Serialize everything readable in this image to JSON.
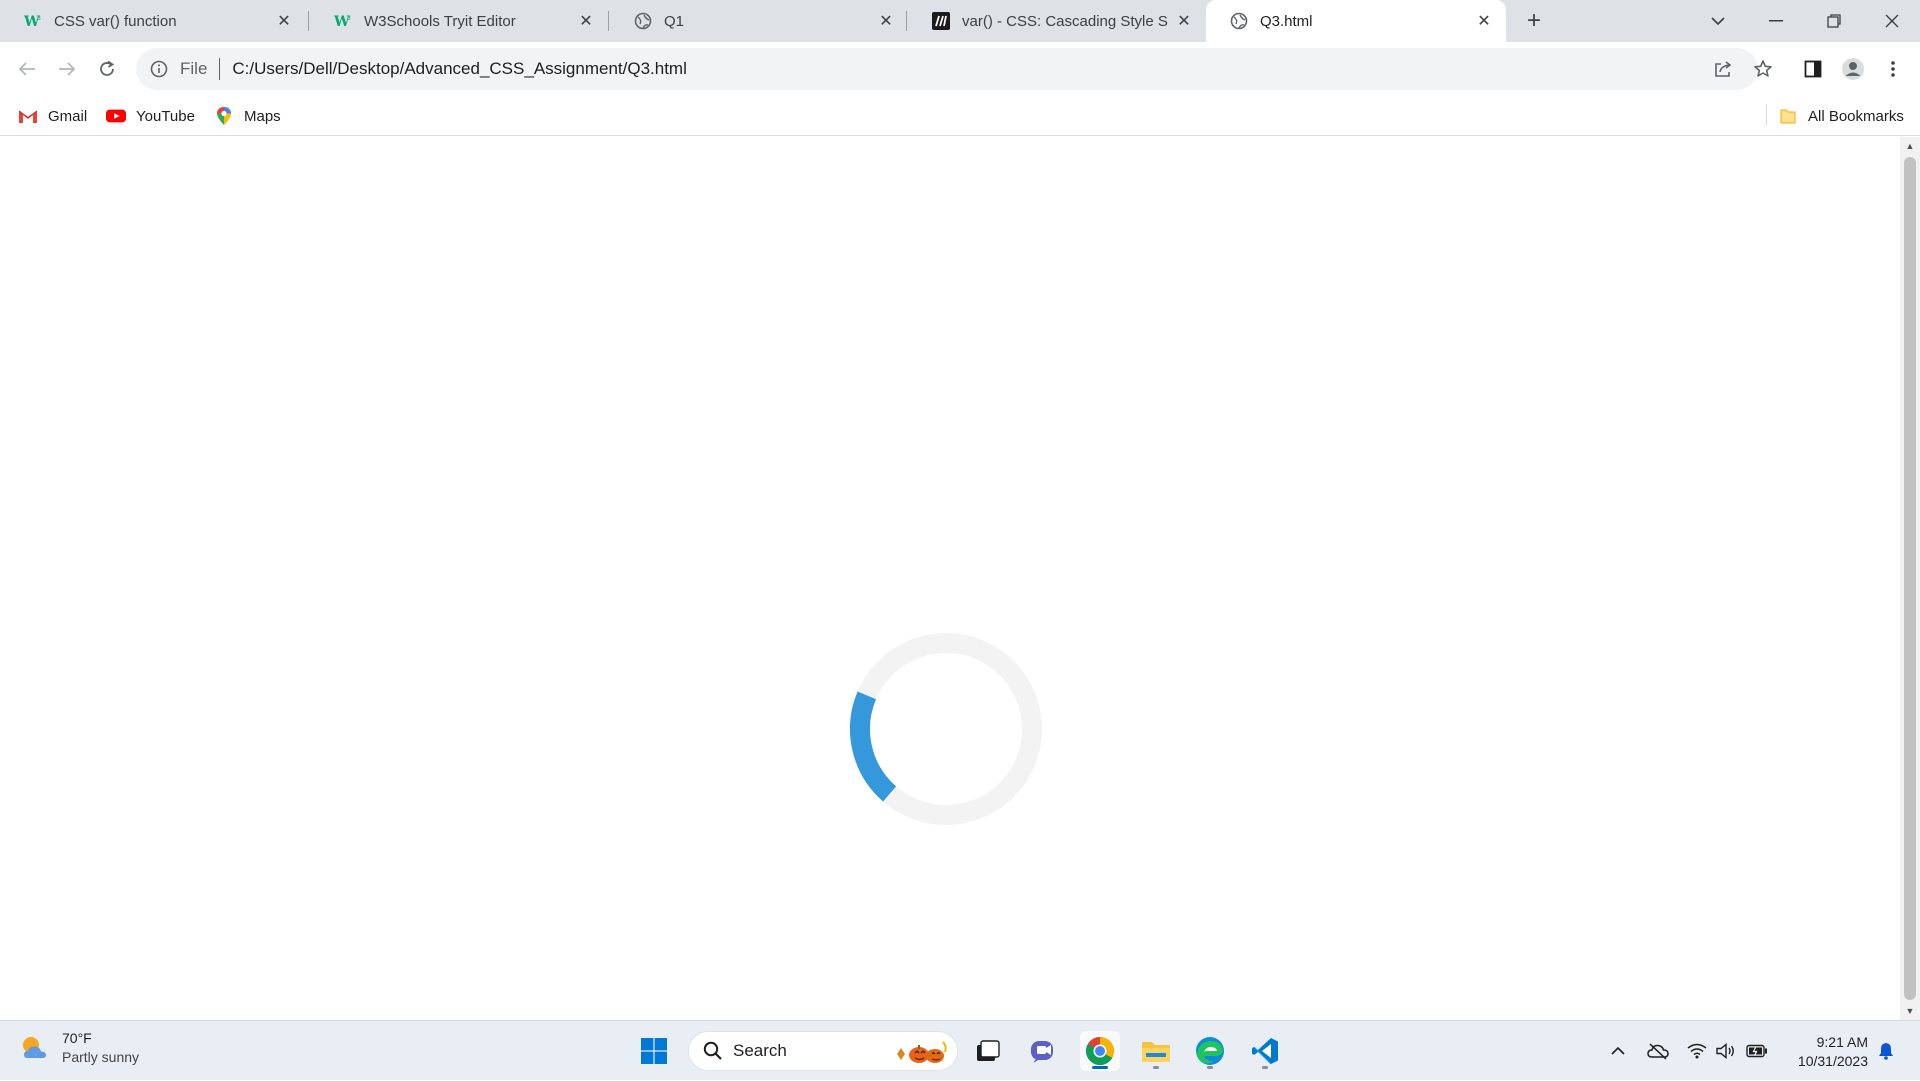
{
  "tabs": [
    {
      "title": "CSS var() function",
      "icon": "w3schools-icon"
    },
    {
      "title": "W3Schools Tryit Editor",
      "icon": "w3schools-icon"
    },
    {
      "title": "Q1",
      "icon": "globe-icon"
    },
    {
      "title": "var() - CSS: Cascading Style Shee",
      "icon": "mdn-icon"
    },
    {
      "title": "Q3.html",
      "icon": "globe-icon",
      "active": true
    }
  ],
  "toolbar": {
    "scheme": "File",
    "url": "C:/Users/Dell/Desktop/Advanced_CSS_Assignment/Q3.html"
  },
  "bookmarks": {
    "items": [
      {
        "label": "Gmail",
        "icon": "gmail-icon"
      },
      {
        "label": "YouTube",
        "icon": "youtube-icon"
      },
      {
        "label": "Maps",
        "icon": "maps-icon"
      }
    ],
    "all_bookmarks": "All Bookmarks"
  },
  "page": {
    "loader": {
      "track_color": "#f3f3f3",
      "arc_color": "#3498db",
      "arc_fraction": 0.2
    }
  },
  "taskbar": {
    "weather": {
      "temp": "70°F",
      "condition": "Partly sunny"
    },
    "search_label": "Search",
    "pinned": [
      "windows-start-icon",
      "search-icon",
      "task-view-icon",
      "teams-chat-icon",
      "chrome-icon",
      "file-explorer-icon",
      "edge-icon",
      "vscode-icon"
    ],
    "clock": {
      "time": "9:21 AM",
      "date": "10/31/2023"
    }
  },
  "colors": {
    "tabstrip": "#dee1e6",
    "accent": "#0067c0"
  }
}
